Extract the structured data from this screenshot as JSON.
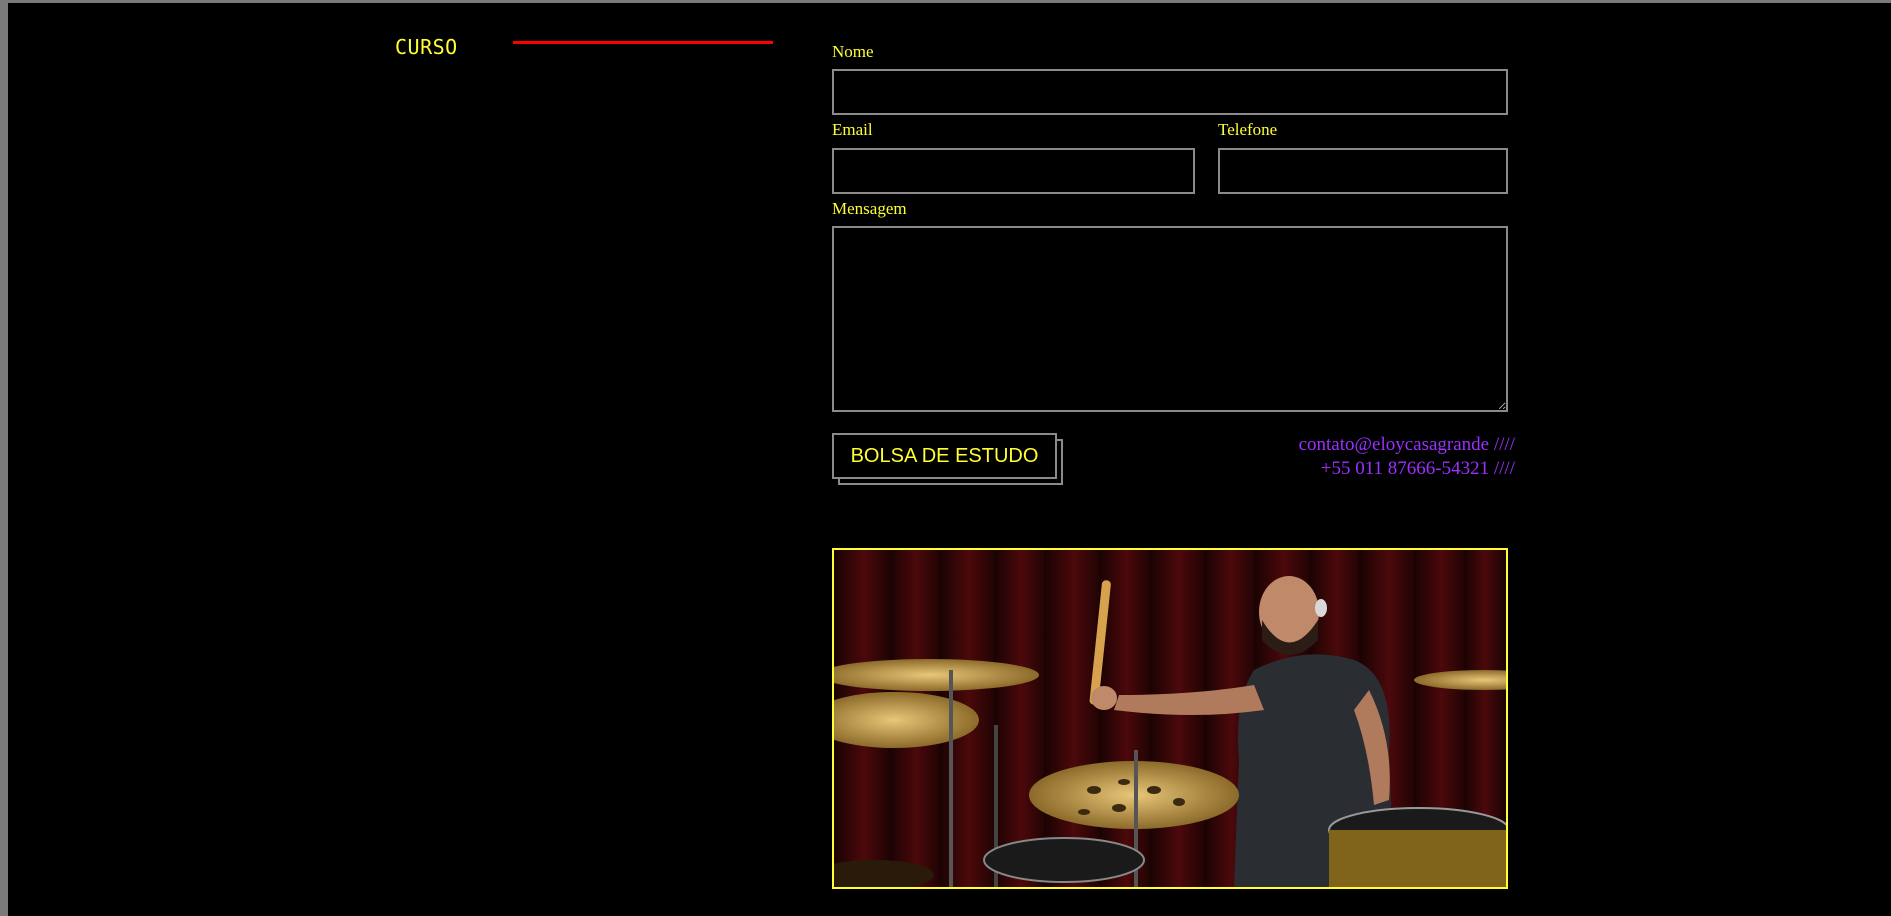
{
  "sidebar": {
    "title": "CURSO"
  },
  "form": {
    "name_label": "Nome",
    "name_value": "",
    "email_label": "Email",
    "email_value": "",
    "phone_label": "Telefone",
    "phone_value": "",
    "message_label": "Mensagem",
    "message_value": "",
    "submit_label": "BOLSA DE ESTUDO"
  },
  "contact": {
    "email_text": "contato@eloycasagrande",
    "phone_text": "+55 011 87666-54321",
    "separator": "////"
  },
  "photo": {
    "subject": "drummer-playing-drum-kit"
  },
  "colors": {
    "background": "#000000",
    "accent_yellow": "#ffff33",
    "accent_red": "#ff0000",
    "contact_purple": "#9b30ff",
    "field_border": "#8a8a8a"
  }
}
